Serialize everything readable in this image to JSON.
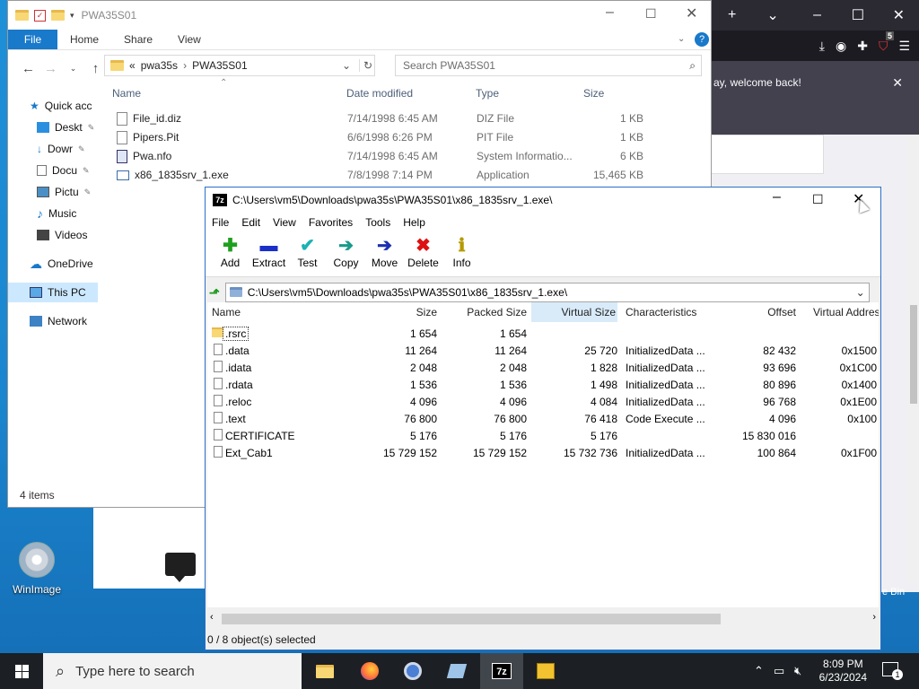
{
  "explorer": {
    "title": "PWA35S01",
    "ribbon_tabs": [
      "File",
      "Home",
      "Share",
      "View"
    ],
    "breadcrumb": [
      "«",
      "pwa35s",
      "›",
      "PWA35S01"
    ],
    "search_placeholder": "Search PWA35S01",
    "nav": [
      "Quick acc",
      "Deskt",
      "Dowr",
      "Docu",
      "Pictu",
      "Music",
      "Videos",
      "OneDrive",
      "This PC",
      "Network"
    ],
    "columns": [
      "Name",
      "Date modified",
      "Type",
      "Size"
    ],
    "files": [
      {
        "name": "File_id.diz",
        "date": "7/14/1998 6:45 AM",
        "type": "DIZ File",
        "size": "1 KB"
      },
      {
        "name": "Pipers.Pit",
        "date": "6/6/1998 6:26 PM",
        "type": "PIT File",
        "size": "1 KB"
      },
      {
        "name": "Pwa.nfo",
        "date": "7/14/1998 6:45 AM",
        "type": "System Informatio...",
        "size": "6 KB"
      },
      {
        "name": "x86_1835srv_1.exe",
        "date": "7/8/1998 7:14 PM",
        "type": "Application",
        "size": "15,465 KB"
      }
    ],
    "status": "4 items"
  },
  "browser": {
    "notice": "ay, welcome back!",
    "tab_close": "✕",
    "badge": "5"
  },
  "sevenzip": {
    "title": "C:\\Users\\vm5\\Downloads\\pwa35s\\PWA35S01\\x86_1835srv_1.exe\\",
    "menu": [
      "File",
      "Edit",
      "View",
      "Favorites",
      "Tools",
      "Help"
    ],
    "toolbar": [
      "Add",
      "Extract",
      "Test",
      "Copy",
      "Move",
      "Delete",
      "Info"
    ],
    "path": "C:\\Users\\vm5\\Downloads\\pwa35s\\PWA35S01\\x86_1835srv_1.exe\\",
    "columns": [
      "Name",
      "Size",
      "Packed Size",
      "Virtual Size",
      "Characteristics",
      "Offset",
      "Virtual Addres"
    ],
    "rows": [
      {
        "name": ".rsrc",
        "size": "1 654",
        "packed": "1 654",
        "vsize": "",
        "chars": "",
        "offset": "",
        "vaddr": ""
      },
      {
        "name": ".data",
        "size": "11 264",
        "packed": "11 264",
        "vsize": "25 720",
        "chars": "InitializedData ...",
        "offset": "82 432",
        "vaddr": "0x1500"
      },
      {
        "name": ".idata",
        "size": "2 048",
        "packed": "2 048",
        "vsize": "1 828",
        "chars": "InitializedData ...",
        "offset": "93 696",
        "vaddr": "0x1C00"
      },
      {
        "name": ".rdata",
        "size": "1 536",
        "packed": "1 536",
        "vsize": "1 498",
        "chars": "InitializedData ...",
        "offset": "80 896",
        "vaddr": "0x1400"
      },
      {
        "name": ".reloc",
        "size": "4 096",
        "packed": "4 096",
        "vsize": "4 084",
        "chars": "InitializedData ...",
        "offset": "96 768",
        "vaddr": "0x1E00"
      },
      {
        "name": ".text",
        "size": "76 800",
        "packed": "76 800",
        "vsize": "76 418",
        "chars": "Code Execute ...",
        "offset": "4 096",
        "vaddr": "0x100"
      },
      {
        "name": "CERTIFICATE",
        "size": "5 176",
        "packed": "5 176",
        "vsize": "5 176",
        "chars": "",
        "offset": "15 830 016",
        "vaddr": ""
      },
      {
        "name": "Ext_Cab1",
        "size": "15 729 152",
        "packed": "15 729 152",
        "vsize": "15 732 736",
        "chars": "InitializedData ...",
        "offset": "100 864",
        "vaddr": "0x1F00"
      }
    ],
    "status": "0 / 8 object(s) selected"
  },
  "desktop": {
    "icon_label": "WinImage",
    "recycle_partial": "e Bin"
  },
  "taskbar": {
    "search_placeholder": "Type here to search",
    "time": "8:09 PM",
    "date": "6/23/2024",
    "notif_count": "1"
  },
  "colors": {
    "accent": "#1979ca",
    "taskbar": "#1c2024",
    "desktop": "#1d8fd6"
  }
}
